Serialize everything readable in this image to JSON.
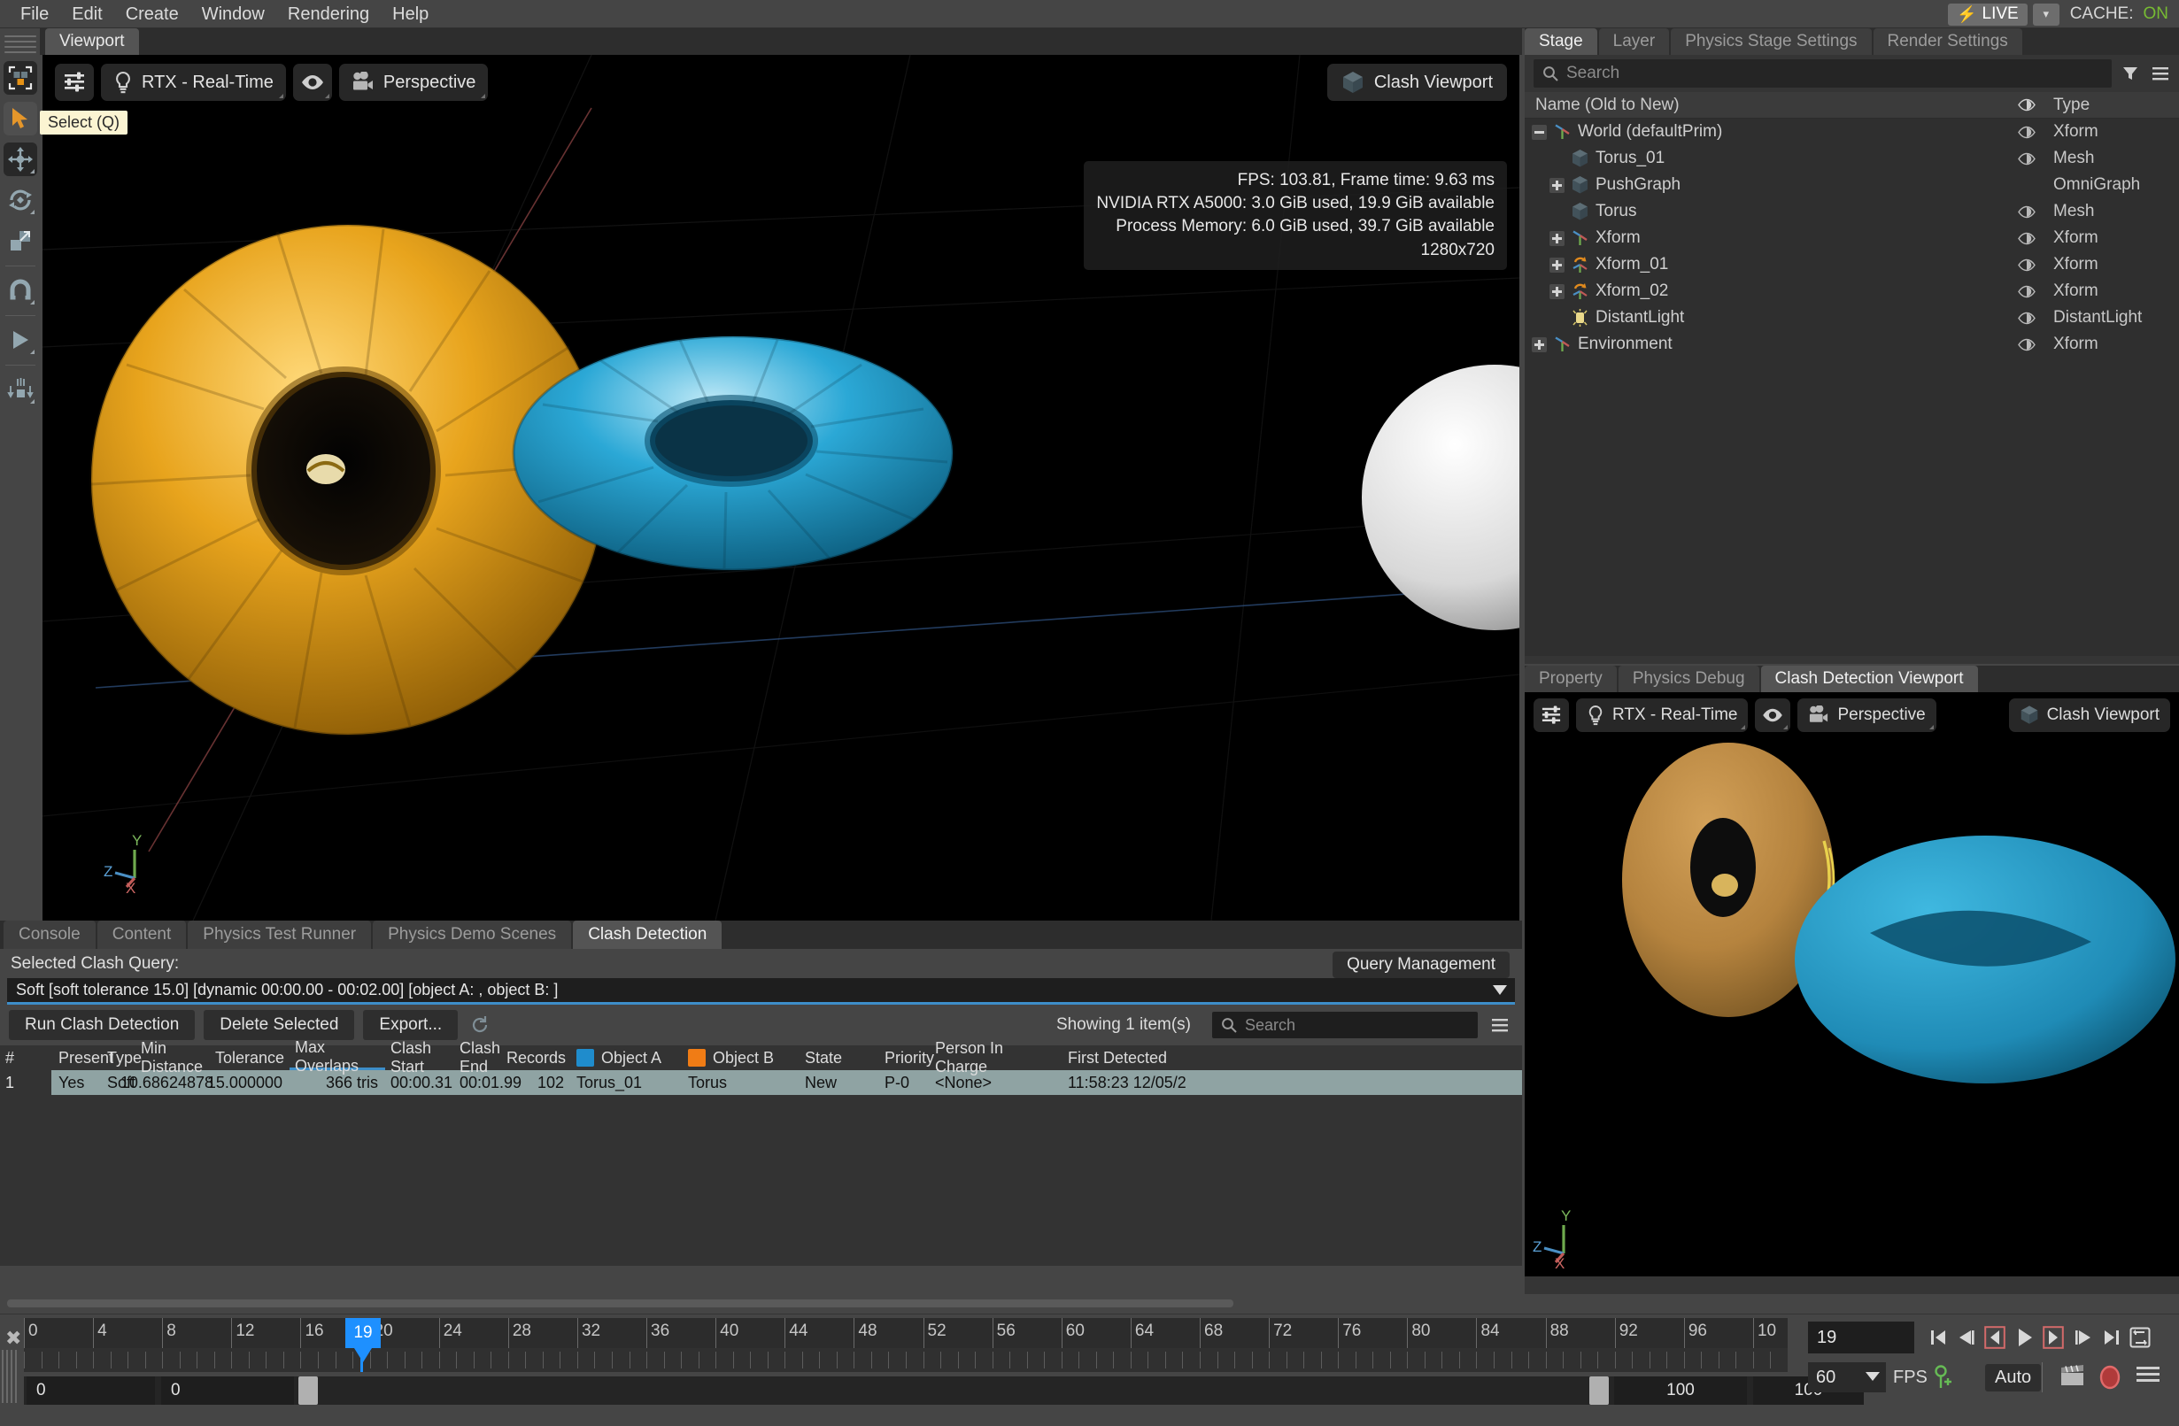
{
  "app": {
    "menu": [
      "File",
      "Edit",
      "Create",
      "Window",
      "Rendering",
      "Help"
    ],
    "live_label": "LIVE",
    "cache_label": "CACHE:",
    "cache_value": "ON"
  },
  "left_rail": {
    "tooltip": "Select (Q)",
    "items": [
      {
        "name": "selection-mode-icon"
      },
      {
        "name": "select-tool-icon"
      },
      {
        "name": "move-tool-icon"
      },
      {
        "name": "rotate-tool-icon"
      },
      {
        "name": "scale-tool-icon"
      },
      {
        "name": "snap-tool-icon"
      },
      {
        "name": "play-tool-icon"
      },
      {
        "name": "physics-drop-tool-icon"
      }
    ]
  },
  "viewport": {
    "tab_label": "Viewport",
    "renderer": "RTX - Real-Time",
    "camera": "Perspective",
    "clash_viewport_button": "Clash Viewport",
    "stats": [
      "FPS: 103.81, Frame time: 9.63 ms",
      "NVIDIA RTX A5000: 3.0 GiB used, 19.9 GiB available",
      "Process Memory: 6.0 GiB used, 39.7 GiB available",
      "1280x720"
    ],
    "axis": {
      "x": "X",
      "y": "Y",
      "z": "Z"
    }
  },
  "stage": {
    "tabs": [
      {
        "label": "Stage",
        "active": true
      },
      {
        "label": "Layer",
        "active": false
      },
      {
        "label": "Physics Stage Settings",
        "active": false
      },
      {
        "label": "Render Settings",
        "active": false
      }
    ],
    "search_placeholder": "Search",
    "columns": {
      "name": "Name (Old to New)",
      "type": "Type"
    },
    "rows": [
      {
        "label": "World (defaultPrim)",
        "type": "Xform",
        "indent": 0,
        "expander": "minus",
        "icon": "axis-icon",
        "eye": true
      },
      {
        "label": "Torus_01",
        "type": "Mesh",
        "indent": 1,
        "expander": "none",
        "icon": "mesh-icon",
        "eye": true
      },
      {
        "label": "PushGraph",
        "type": "OmniGraph",
        "indent": 1,
        "expander": "plus",
        "icon": "mesh-icon",
        "eye": false
      },
      {
        "label": "Torus",
        "type": "Mesh",
        "indent": 1,
        "expander": "none",
        "icon": "mesh-icon",
        "eye": true
      },
      {
        "label": "Xform",
        "type": "Xform",
        "indent": 1,
        "expander": "plus",
        "icon": "axis-icon",
        "eye": true
      },
      {
        "label": "Xform_01",
        "type": "Xform",
        "indent": 1,
        "expander": "plus",
        "icon": "axis-rot-icon",
        "eye": true
      },
      {
        "label": "Xform_02",
        "type": "Xform",
        "indent": 1,
        "expander": "plus",
        "icon": "axis-rot-icon",
        "eye": true
      },
      {
        "label": "DistantLight",
        "type": "DistantLight",
        "indent": 1,
        "expander": "none",
        "icon": "light-icon",
        "eye": true
      },
      {
        "label": "Environment",
        "type": "Xform",
        "indent": 0,
        "expander": "plus",
        "icon": "axis-icon",
        "eye": true
      }
    ]
  },
  "clash_viewport_panel": {
    "tabs": [
      {
        "label": "Property",
        "active": false
      },
      {
        "label": "Physics Debug",
        "active": false
      },
      {
        "label": "Clash Detection Viewport",
        "active": true
      }
    ],
    "renderer": "RTX - Real-Time",
    "camera": "Perspective",
    "clash_viewport_button": "Clash Viewport",
    "axis": {
      "x": "X",
      "y": "Y",
      "z": "Z"
    }
  },
  "bottom_dock": {
    "tabs": [
      {
        "label": "Console",
        "active": false
      },
      {
        "label": "Content",
        "active": false
      },
      {
        "label": "Physics Test Runner",
        "active": false
      },
      {
        "label": "Physics Demo Scenes",
        "active": false
      },
      {
        "label": "Clash Detection",
        "active": true
      }
    ],
    "selected_clash_query_label": "Selected Clash Query:",
    "query_management_button": "Query Management",
    "query_value": "Soft [soft tolerance 15.0] [dynamic 00:00.00 - 00:02.00] [object A: , object B: ]",
    "buttons": {
      "run": "Run Clash Detection",
      "delete": "Delete Selected",
      "export": "Export..."
    },
    "refresh_icon": "refresh-icon",
    "showing": "Showing 1 item(s)",
    "search_placeholder": "Search",
    "table": {
      "columns": [
        {
          "label": "#",
          "width": 60,
          "align": "left"
        },
        {
          "label": "Present",
          "width": 55,
          "align": "left"
        },
        {
          "label": "Type",
          "width": 38,
          "align": "left"
        },
        {
          "label": "Min Distance",
          "width": 96,
          "align": "right"
        },
        {
          "label": "Tolerance",
          "width": 78,
          "align": "right"
        },
        {
          "label": "Max Overlaps",
          "width": 108,
          "align": "right",
          "highlight": true
        },
        {
          "label": "Clash Start",
          "width": 78,
          "align": "left"
        },
        {
          "label": "Clash End",
          "width": 70,
          "align": "left"
        },
        {
          "label": "Records",
          "width": 62,
          "align": "right"
        },
        {
          "label": "Object A",
          "width": 126,
          "align": "left",
          "swatch": "#1f8ccc"
        },
        {
          "label": "Object B",
          "width": 132,
          "align": "left",
          "swatch": "#f07c15"
        },
        {
          "label": "State",
          "width": 90,
          "align": "left"
        },
        {
          "label": "Priority",
          "width": 57,
          "align": "left"
        },
        {
          "label": "Person In Charge",
          "width": 150,
          "align": "left"
        },
        {
          "label": "First Detected",
          "width": 160,
          "align": "left"
        }
      ],
      "rows": [
        {
          "index": "1",
          "present": "Yes",
          "type": "Soft",
          "min_distance": "10.68624878",
          "tolerance": "15.000000",
          "max_overlaps": "366  tris",
          "clash_start": "00:00.31",
          "clash_end": "00:01.99",
          "records": "102",
          "object_a": "Torus_01",
          "object_b": "Torus",
          "state": "New",
          "priority": "P-0",
          "person_in_charge": "<None>",
          "first_detected": "11:58:23 12/05/2"
        }
      ]
    }
  },
  "timeline": {
    "tick_labels": [
      "0",
      "4",
      "8",
      "12",
      "16",
      "20",
      "24",
      "28",
      "32",
      "36",
      "40",
      "44",
      "48",
      "52",
      "56",
      "60",
      "64",
      "68",
      "72",
      "76",
      "80",
      "84",
      "88",
      "92",
      "96",
      "10"
    ],
    "playhead_frame": "19",
    "range_start": "0",
    "range_start2": "0",
    "range_end": "100",
    "range_end2": "100",
    "current_frame": "19",
    "fps_value": "60",
    "fps_label": "FPS",
    "auto_label": "Auto",
    "controls": [
      "skip-start-icon",
      "step-back-fast-icon",
      "play-reverse-icon",
      "play-icon",
      "play-forward-icon",
      "step-forward-fast-icon",
      "skip-end-icon",
      "loop-icon"
    ],
    "extra_icons": [
      "keyframe-add-icon",
      "clapperboard-icon",
      "record-icon",
      "menu-icon"
    ]
  }
}
